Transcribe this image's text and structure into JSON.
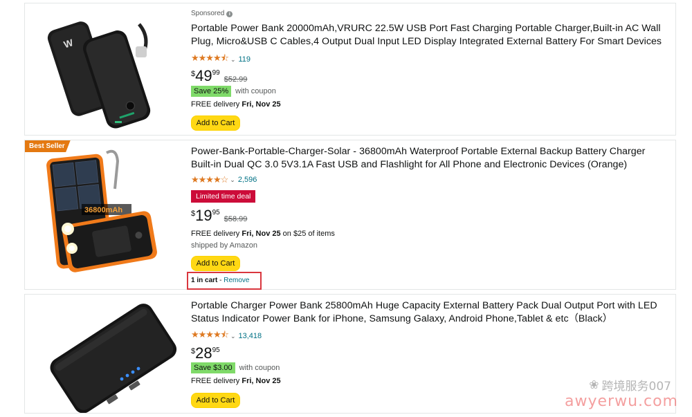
{
  "products": [
    {
      "sponsored_label": "Sponsored",
      "title": "Portable Power Bank 20000mAh,VRURC 22.5W USB Port Fast Charging Portable Charger,Built-in AC Wall Plug, Micro&USB C Cables,4 Output Dual Input LED Display Integrated External Battery For Smart Devices",
      "stars": "★★★★⯪",
      "rating_count": "119",
      "price_symbol": "$",
      "price_whole": "49",
      "price_fraction": "99",
      "list_price": "$52.99",
      "coupon_badge": "Save 25%",
      "coupon_text": "with coupon",
      "delivery_prefix": "FREE delivery",
      "delivery_date": "Fri, Nov 25",
      "add_to_cart": "Add to Cart"
    },
    {
      "badge": "Best Seller",
      "title": "Power-Bank-Portable-Charger-Solar - 36800mAh Waterproof Portable External Backup Battery Charger Built-in Dual QC 3.0 5V3.1A Fast USB and Flashlight for All Phone and Electronic Devices (Orange)",
      "stars": "★★★★☆",
      "rating_count": "2,596",
      "deal_label": "Limited time deal",
      "price_symbol": "$",
      "price_whole": "19",
      "price_fraction": "95",
      "list_price": "$58.99",
      "delivery_prefix": "FREE delivery",
      "delivery_date": "Fri, Nov 25",
      "delivery_suffix": "on $25 of items",
      "shipped_by": "shipped by Amazon",
      "add_to_cart": "Add to Cart",
      "in_cart_text": "1 in cart",
      "in_cart_sep": " - ",
      "remove_label": "Remove",
      "image_label": "36800mAh"
    },
    {
      "title": "Portable Charger Power Bank 25800mAh Huge Capacity External Battery Pack Dual Output Port with LED Status Indicator Power Bank for iPhone, Samsung Galaxy, Android Phone,Tablet & etc（Black）",
      "stars": "★★★★⯪",
      "rating_count": "13,418",
      "price_symbol": "$",
      "price_whole": "28",
      "price_fraction": "95",
      "coupon_badge": "Save $3.00",
      "coupon_text": "with coupon",
      "delivery_prefix": "FREE delivery",
      "delivery_date": "Fri, Nov 25",
      "add_to_cart": "Add to Cart"
    }
  ],
  "watermark": {
    "cn": "跨境服务007",
    "url": "awyerwu.com"
  },
  "colors": {
    "star": "#de7921",
    "link": "#007185",
    "cart_button": "#ffd814",
    "deal": "#cc0c39",
    "coupon": "#7fda69",
    "best_seller": "#e47911",
    "highlight_box": "#d9363e"
  }
}
